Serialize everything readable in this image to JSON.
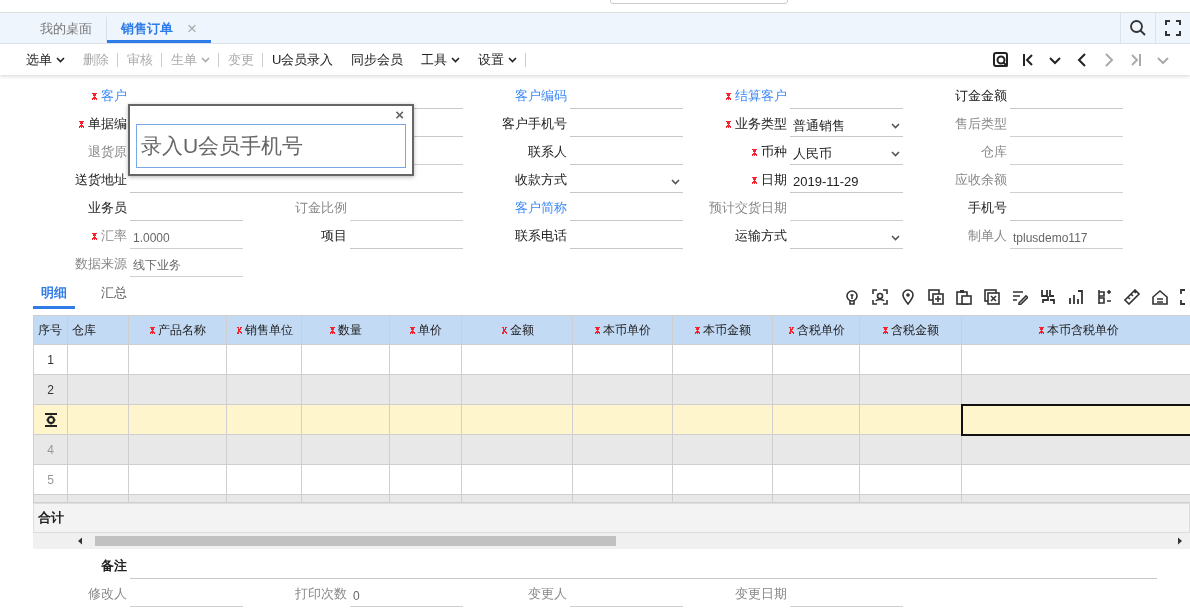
{
  "tabs": [
    {
      "label": "我的桌面",
      "selected": false
    },
    {
      "label": "销售订单",
      "selected": true,
      "close": "×"
    }
  ],
  "toolbar": [
    {
      "label": "选单",
      "disabled": false,
      "dropdown": true,
      "separator_after": false
    },
    {
      "label": "删除",
      "disabled": true,
      "dropdown": false,
      "separator_after": true
    },
    {
      "label": "审核",
      "disabled": true,
      "dropdown": false,
      "separator_after": true
    },
    {
      "label": "生单",
      "disabled": true,
      "dropdown": true,
      "separator_after": true
    },
    {
      "label": "变更",
      "disabled": true,
      "dropdown": false,
      "separator_after": true
    },
    {
      "label": "U会员录入",
      "disabled": false,
      "dropdown": false,
      "separator_after": false
    },
    {
      "label": "同步会员",
      "disabled": false,
      "dropdown": false,
      "separator_after": false
    },
    {
      "label": "工具",
      "disabled": false,
      "dropdown": true,
      "separator_after": false
    },
    {
      "label": "设置",
      "disabled": false,
      "dropdown": true,
      "separator_after": true
    }
  ],
  "nav": [
    {
      "kind": "preview",
      "disabled": false
    },
    {
      "kind": "first",
      "disabled": false
    },
    {
      "kind": "menu",
      "disabled": false
    },
    {
      "kind": "prev",
      "disabled": false
    },
    {
      "kind": "next",
      "disabled": true
    },
    {
      "kind": "last",
      "disabled": true
    },
    {
      "kind": "menu",
      "disabled": true
    }
  ],
  "form": [
    [
      {
        "label": "客户",
        "required": true,
        "link": true,
        "disabled": false,
        "wide": true,
        "dropdown": false
      },
      {
        "label": "客户编码",
        "required": false,
        "link": true,
        "disabled": false,
        "wide": false,
        "dropdown": false
      },
      {
        "label": "结算客户",
        "required": true,
        "link": true,
        "disabled": false,
        "wide": false,
        "dropdown": false
      },
      {
        "label": "订金金额",
        "required": false,
        "link": false,
        "disabled": false,
        "wide": false,
        "dropdown": false
      }
    ],
    [
      {
        "label": "单据编",
        "required": true,
        "link": false,
        "disabled": false,
        "wide": true,
        "dropdown": false
      },
      {
        "label": "客户手机号",
        "required": false,
        "link": false,
        "disabled": false,
        "wide": false,
        "dropdown": false
      },
      {
        "label": "业务类型",
        "required": true,
        "link": false,
        "disabled": false,
        "wide": false,
        "dropdown": true,
        "value": "普通销售"
      },
      {
        "label": "售后类型",
        "required": false,
        "link": false,
        "disabled": true,
        "wide": false,
        "dropdown": false
      }
    ],
    [
      {
        "label": "退货原",
        "required": false,
        "link": false,
        "disabled": true,
        "wide": true,
        "dropdown": false
      },
      {
        "label": "联系人",
        "required": false,
        "link": false,
        "disabled": false,
        "wide": false,
        "dropdown": false
      },
      {
        "label": "币种",
        "required": true,
        "link": false,
        "disabled": false,
        "wide": false,
        "dropdown": true,
        "value": "人民币"
      },
      {
        "label": "仓库",
        "required": false,
        "link": false,
        "disabled": true,
        "wide": false,
        "dropdown": false
      }
    ],
    [
      {
        "label": "送货地址",
        "required": false,
        "link": false,
        "disabled": false,
        "wide": true,
        "dropdown": false
      },
      {
        "label": "收款方式",
        "required": false,
        "link": false,
        "disabled": false,
        "wide": false,
        "dropdown": true
      },
      {
        "label": "日期",
        "required": true,
        "link": false,
        "disabled": false,
        "wide": false,
        "dropdown": false,
        "value": "2019-11-29"
      },
      {
        "label": "应收余额",
        "required": false,
        "link": false,
        "disabled": true,
        "wide": false,
        "dropdown": false
      }
    ],
    [
      {
        "label": "业务员",
        "required": false,
        "link": false,
        "disabled": false,
        "wide": false,
        "dropdown": false
      },
      {
        "label": "订金比例",
        "required": false,
        "link": false,
        "disabled": true,
        "wide": false,
        "dropdown": false
      },
      {
        "label": "客户简称",
        "required": false,
        "link": true,
        "disabled": false,
        "wide": false,
        "dropdown": false
      },
      {
        "label": "预计交货日期",
        "required": false,
        "link": false,
        "disabled": true,
        "wide": false,
        "dropdown": false
      },
      {
        "label": "手机号",
        "required": false,
        "link": false,
        "disabled": false,
        "wide": false,
        "dropdown": false
      }
    ],
    [
      {
        "label": "汇率",
        "required": true,
        "link": false,
        "disabled": true,
        "wide": false,
        "dropdown": false,
        "value": "1.0000"
      },
      {
        "label": "项目",
        "required": false,
        "link": false,
        "disabled": false,
        "wide": false,
        "dropdown": false
      },
      {
        "label": "联系电话",
        "required": false,
        "link": false,
        "disabled": false,
        "wide": false,
        "dropdown": false
      },
      {
        "label": "运输方式",
        "required": false,
        "link": false,
        "disabled": false,
        "wide": false,
        "dropdown": true
      },
      {
        "label": "制单人",
        "required": false,
        "link": false,
        "disabled": true,
        "wide": false,
        "dropdown": false,
        "value": "tplusdemo117"
      }
    ],
    [
      {
        "label": "数据来源",
        "required": false,
        "link": false,
        "disabled": true,
        "wide": false,
        "dropdown": false,
        "value": "线下业务"
      }
    ]
  ],
  "popup": {
    "close": "×",
    "placeholder": "录入U会员手机号"
  },
  "detail_tabs": [
    {
      "label": "明细",
      "selected": true
    },
    {
      "label": "汇总",
      "selected": false
    }
  ],
  "grid_tools": [
    {
      "kind": "bulb"
    },
    {
      "kind": "scan"
    },
    {
      "kind": "pin"
    },
    {
      "kind": "add"
    },
    {
      "kind": "paste"
    },
    {
      "kind": "copy"
    },
    {
      "kind": "edit"
    },
    {
      "kind": "split"
    },
    {
      "kind": "chart"
    },
    {
      "kind": "branch"
    },
    {
      "kind": "ruler"
    },
    {
      "kind": "home"
    },
    {
      "kind": "expand"
    }
  ],
  "table": {
    "columns": [
      {
        "label": "序号",
        "required": false
      },
      {
        "label": "仓库",
        "required": false
      },
      {
        "label": "产品名称",
        "required": true
      },
      {
        "label": "销售单位",
        "required": true
      },
      {
        "label": "数量",
        "required": true
      },
      {
        "label": "单价",
        "required": true
      },
      {
        "label": "金额",
        "required": true
      },
      {
        "label": "本币单价",
        "required": true
      },
      {
        "label": "本币金额",
        "required": true
      },
      {
        "label": "含税单价",
        "required": true
      },
      {
        "label": "含税金额",
        "required": true
      },
      {
        "label": "本币含税单价",
        "required": true
      }
    ],
    "rows": [
      {
        "number": "1",
        "selected": false,
        "dimmed": false
      },
      {
        "number": "2",
        "selected": false,
        "dimmed": false
      },
      {
        "selected": true
      },
      {
        "number": "4",
        "selected": false,
        "dimmed": true
      },
      {
        "number": "5",
        "selected": false,
        "dimmed": true
      },
      {
        "selected": false
      }
    ],
    "total_label": "合计"
  },
  "footer": {
    "remark": {
      "label": "备注"
    },
    "fields": [
      {
        "label": "修改人",
        "disabled": true
      },
      {
        "label": "打印次数",
        "disabled": true,
        "value": "0"
      },
      {
        "label": "变更人",
        "disabled": true
      },
      {
        "label": "变更日期",
        "disabled": true
      }
    ]
  }
}
